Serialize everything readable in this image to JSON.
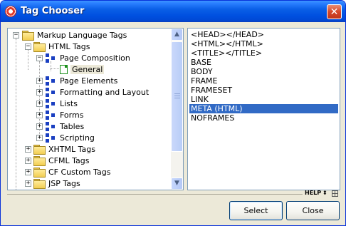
{
  "window": {
    "title": "Tag Chooser",
    "close_symbol": "✕"
  },
  "tree": {
    "items": [
      {
        "label": "Markup Language Tags",
        "icon": "folder-icon",
        "expanded": true
      },
      {
        "label": "HTML Tags",
        "icon": "folder-icon",
        "expanded": true
      },
      {
        "label": "Page Composition",
        "icon": "tag-group-icon",
        "expanded": true
      },
      {
        "label": "General",
        "icon": "document-icon",
        "selected": true
      },
      {
        "label": "Page Elements",
        "icon": "tag-group-icon",
        "expanded": false
      },
      {
        "label": "Formatting and Layout",
        "icon": "tag-group-icon",
        "expanded": false
      },
      {
        "label": "Lists",
        "icon": "tag-group-icon",
        "expanded": false
      },
      {
        "label": "Forms",
        "icon": "tag-group-icon",
        "expanded": false
      },
      {
        "label": "Tables",
        "icon": "tag-group-icon",
        "expanded": false
      },
      {
        "label": "Scripting",
        "icon": "tag-group-icon",
        "expanded": false
      },
      {
        "label": "XHTML Tags",
        "icon": "folder-icon",
        "expanded": false
      },
      {
        "label": "CFML Tags",
        "icon": "folder-icon",
        "expanded": false
      },
      {
        "label": "CF Custom Tags",
        "icon": "folder-icon",
        "expanded": false
      },
      {
        "label": "JSP Tags",
        "icon": "folder-icon",
        "expanded": false
      }
    ],
    "scroll_up": "▲",
    "scroll_down": "▼"
  },
  "tag_list": {
    "items": [
      {
        "label": "<HEAD></HEAD>"
      },
      {
        "label": "<HTML></HTML>"
      },
      {
        "label": "<TITLE></TITLE>"
      },
      {
        "label": "BASE"
      },
      {
        "label": "BODY"
      },
      {
        "label": "FRAME"
      },
      {
        "label": "FRAMESET"
      },
      {
        "label": "LINK"
      },
      {
        "label": "META (HTML)",
        "selected": true
      },
      {
        "label": "NOFRAMES"
      }
    ]
  },
  "help": {
    "label": "HELP",
    "updown": "⬍"
  },
  "buttons": {
    "select": "Select",
    "close": "Close"
  },
  "colors": {
    "titlebar": "#0a5fe6",
    "selection": "#316ac5",
    "close_button": "#d6482a"
  }
}
